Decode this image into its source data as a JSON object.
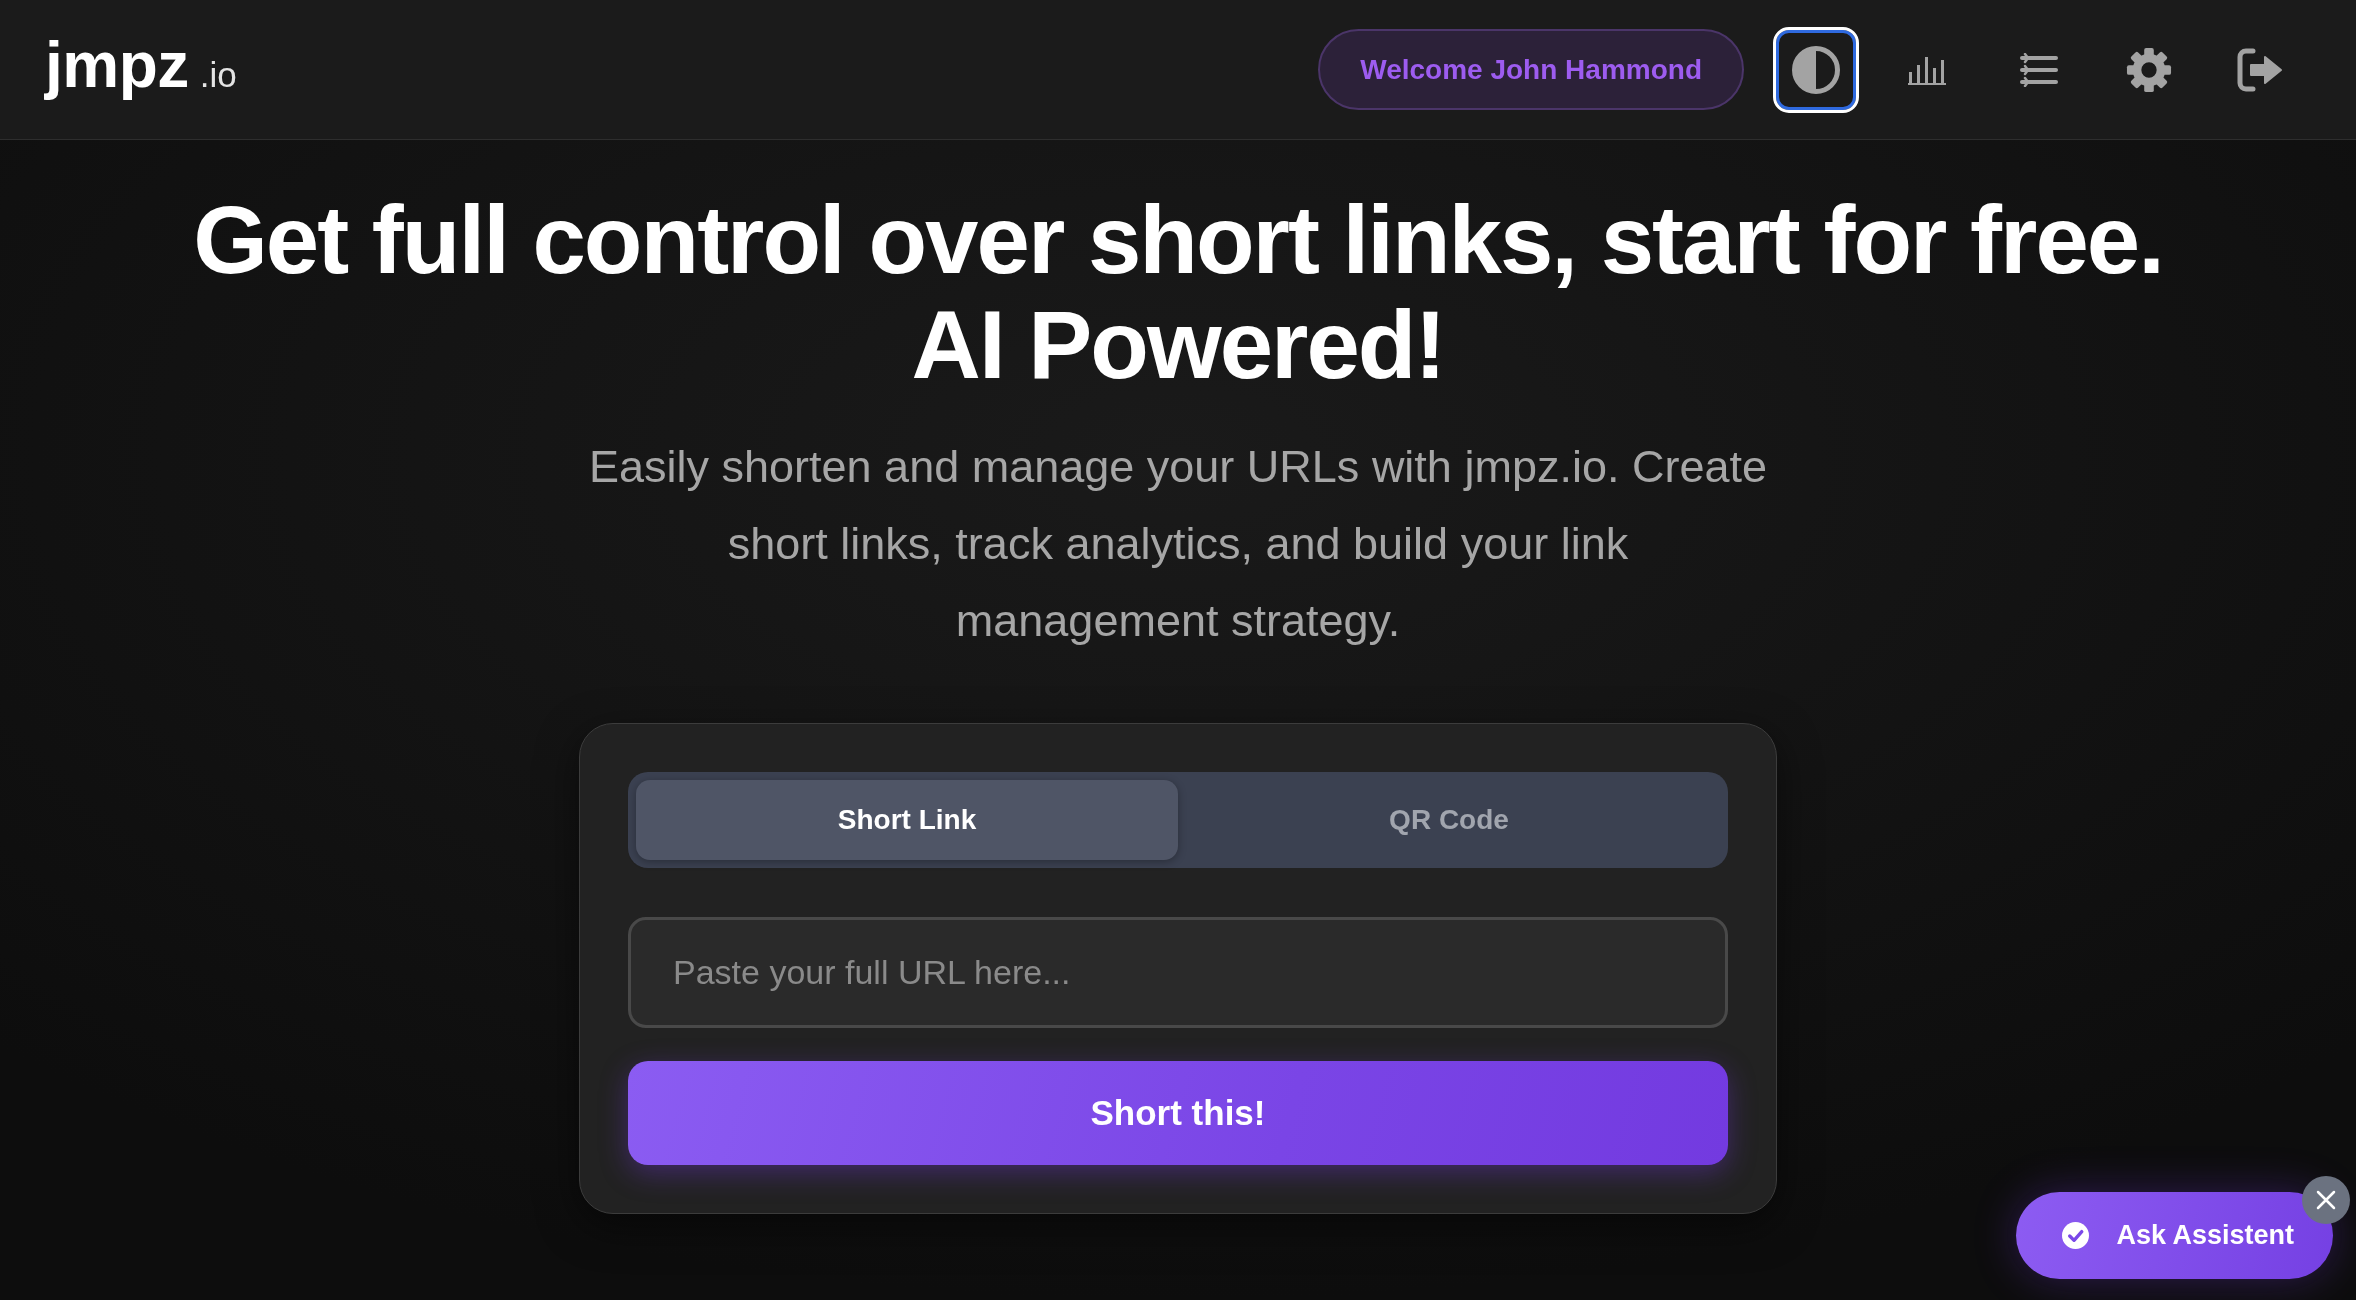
{
  "header": {
    "logo": {
      "name": "jmpz",
      "suffix": ".io"
    },
    "welcome": "Welcome John Hammond",
    "icon_buttons": [
      {
        "kind": "theme",
        "focused": true
      },
      {
        "kind": "stats",
        "focused": false
      },
      {
        "kind": "links",
        "focused": false
      },
      {
        "kind": "settings",
        "focused": false
      },
      {
        "kind": "logout",
        "focused": false
      }
    ]
  },
  "hero": {
    "title": "Get full control over short links, start for free. AI Powered!",
    "subtitle": "Easily shorten and manage your URLs with jmpz.io. Create\nshort links, track analytics, and build your link\nmanagement strategy."
  },
  "shortener": {
    "tabs": [
      {
        "label": "Short Link",
        "selected": true
      },
      {
        "label": "QR Code",
        "selected": false
      }
    ],
    "url_field": {
      "placeholder": "Paste your full URL here..."
    },
    "submit": "Short this!"
  },
  "assistant": {
    "label": "Ask Assistent"
  }
}
